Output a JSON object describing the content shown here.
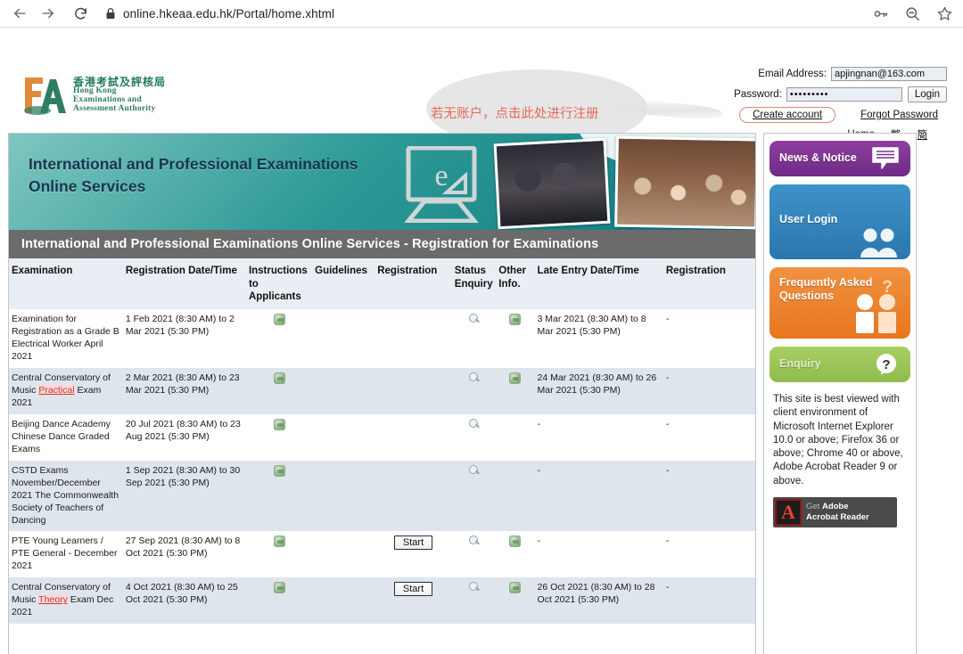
{
  "browser": {
    "url": "online.hkeaa.edu.hk/Portal/home.xhtml",
    "back_label": "Back",
    "forward_label": "Forward",
    "reload_label": "Reload",
    "lock_label": "Site information",
    "password_key_label": "Saved passwords",
    "zoom_label": "Zoom out",
    "bookmark_label": "Bookmark this page"
  },
  "header": {
    "logo": {
      "chinese": "香港考試及評核局",
      "line1": "Hong Kong",
      "line2": "Examinations and",
      "line3": "Assessment Authority"
    },
    "annotation": "若无账户，点击此处进行注册",
    "login": {
      "email_label": "Email Address:",
      "email_value": "apjingnan@163.com",
      "email_placeholder": "",
      "password_label": "Password:",
      "password_value": "•••••••••",
      "password_placeholder": "",
      "login_button": "Login",
      "create_account": "Create account",
      "forgot_password": "Forgot Password",
      "home": "Home",
      "lang_trad": "繁",
      "lang_simp": "簡"
    }
  },
  "banner": {
    "title_line1": "International and Professional Examinations",
    "title_line2": "Online Services",
    "monitor_letter": "e",
    "subtitle": "International and Professional Examinations Online Services - Registration for Examinations"
  },
  "table": {
    "headers": [
      "Examination",
      "Registration Date/Time",
      "Instructions to Applicants",
      "Guidelines",
      "Registration",
      "Status Enquiry",
      "Other Info.",
      "Late Entry Date/Time",
      "Registration"
    ],
    "rows": [
      {
        "examination": "Examination for Registration as a Grade B Electrical Worker April 2021",
        "exam_prefix": "Examination for Registration as a Grade B Electrical Worker April 2021",
        "exam_link": "",
        "exam_suffix": "",
        "reg_datetime": "1 Feb 2021 (8:30 AM) to 2 Mar 2021 (5:30 PM)",
        "instructions_icon": "pdf-document-icon",
        "guidelines": "",
        "registration": "",
        "status_icon": "magnifier-icon",
        "other_icon": "pdf-document-icon",
        "late_entry": "3 Mar 2021 (8:30 AM) to 8 Mar 2021 (5:30 PM)",
        "late_registration": "-"
      },
      {
        "examination": "Central Conservatory of Music Practical Exam 2021",
        "exam_prefix": "Central Conservatory of Music ",
        "exam_link": "Practical",
        "exam_suffix": " Exam 2021",
        "reg_datetime": "2 Mar 2021 (8:30 AM) to 23 Mar 2021 (5:30 PM)",
        "instructions_icon": "pdf-document-icon",
        "guidelines": "",
        "registration": "",
        "status_icon": "magnifier-icon",
        "other_icon": "pdf-document-icon",
        "late_entry": "24 Mar 2021 (8:30 AM) to 26 Mar 2021 (5:30 PM)",
        "late_registration": "-"
      },
      {
        "examination": "Beijing Dance Academy Chinese Dance Graded Exams",
        "exam_prefix": "Beijing Dance Academy Chinese Dance Graded Exams",
        "exam_link": "",
        "exam_suffix": "",
        "reg_datetime": "20 Jul 2021 (8:30 AM) to 23 Aug 2021 (5:30 PM)",
        "instructions_icon": "pdf-document-icon",
        "guidelines": "",
        "registration": "",
        "status_icon": "magnifier-icon",
        "other_icon": "",
        "late_entry": "-",
        "late_registration": "-"
      },
      {
        "examination": "CSTD Exams November/December 2021 The Commonwealth Society of Teachers of Dancing",
        "exam_prefix": "CSTD Exams November/December 2021 The Commonwealth Society of Teachers of Dancing",
        "exam_link": "",
        "exam_suffix": "",
        "reg_datetime": "1 Sep 2021 (8:30 AM) to 30 Sep 2021 (5:30 PM)",
        "instructions_icon": "pdf-document-icon",
        "guidelines": "",
        "registration": "",
        "status_icon": "magnifier-icon",
        "other_icon": "",
        "late_entry": "-",
        "late_registration": "-"
      },
      {
        "examination": "PTE Young Learners / PTE General - December 2021",
        "exam_prefix": "PTE Young Learners / PTE General - December 2021",
        "exam_link": "",
        "exam_suffix": "",
        "reg_datetime": "27 Sep 2021 (8:30 AM) to 8 Oct 2021 (5:30 PM)",
        "instructions_icon": "pdf-document-icon",
        "guidelines": "",
        "registration": "Start",
        "status_icon": "magnifier-icon",
        "other_icon": "pdf-document-icon",
        "late_entry": "-",
        "late_registration": "-"
      },
      {
        "examination": "Central Conservatory of Music Theory Exam Dec 2021",
        "exam_prefix": "Central Conservatory of Music ",
        "exam_link": "Theory",
        "exam_suffix": " Exam Dec 2021",
        "reg_datetime": "4 Oct 2021 (8:30 AM) to 25 Oct 2021 (5:30 PM)",
        "instructions_icon": "pdf-document-icon",
        "guidelines": "",
        "registration": "Start",
        "status_icon": "magnifier-icon",
        "other_icon": "pdf-document-icon",
        "late_entry": "26 Oct 2021 (8:30 AM) to 28 Oct 2021 (5:30 PM)",
        "late_registration": "-"
      }
    ]
  },
  "sidebar": {
    "tiles": [
      {
        "label": "News & Notice",
        "icon": "speech-bubble-icon",
        "color": "#7a3190"
      },
      {
        "label": "User Login",
        "icon": "two-users-icon",
        "color": "#2f7cb4"
      },
      {
        "label": "Frequently Asked Questions",
        "icon": "faq-people-icon",
        "color": "#ed8126"
      },
      {
        "label": "Enquiry",
        "icon": "question-mark-icon",
        "color": "#9bc656"
      }
    ],
    "browser_note": "This site is best viewed with client environment of Microsoft Internet Explorer 10.0 or above; Firefox 36 or above; Chrome 40 or above, Adobe Acrobat Reader 9 or above.",
    "adobe": {
      "get": "Get ",
      "name": "Adobe",
      "line2": "Acrobat Reader"
    }
  }
}
